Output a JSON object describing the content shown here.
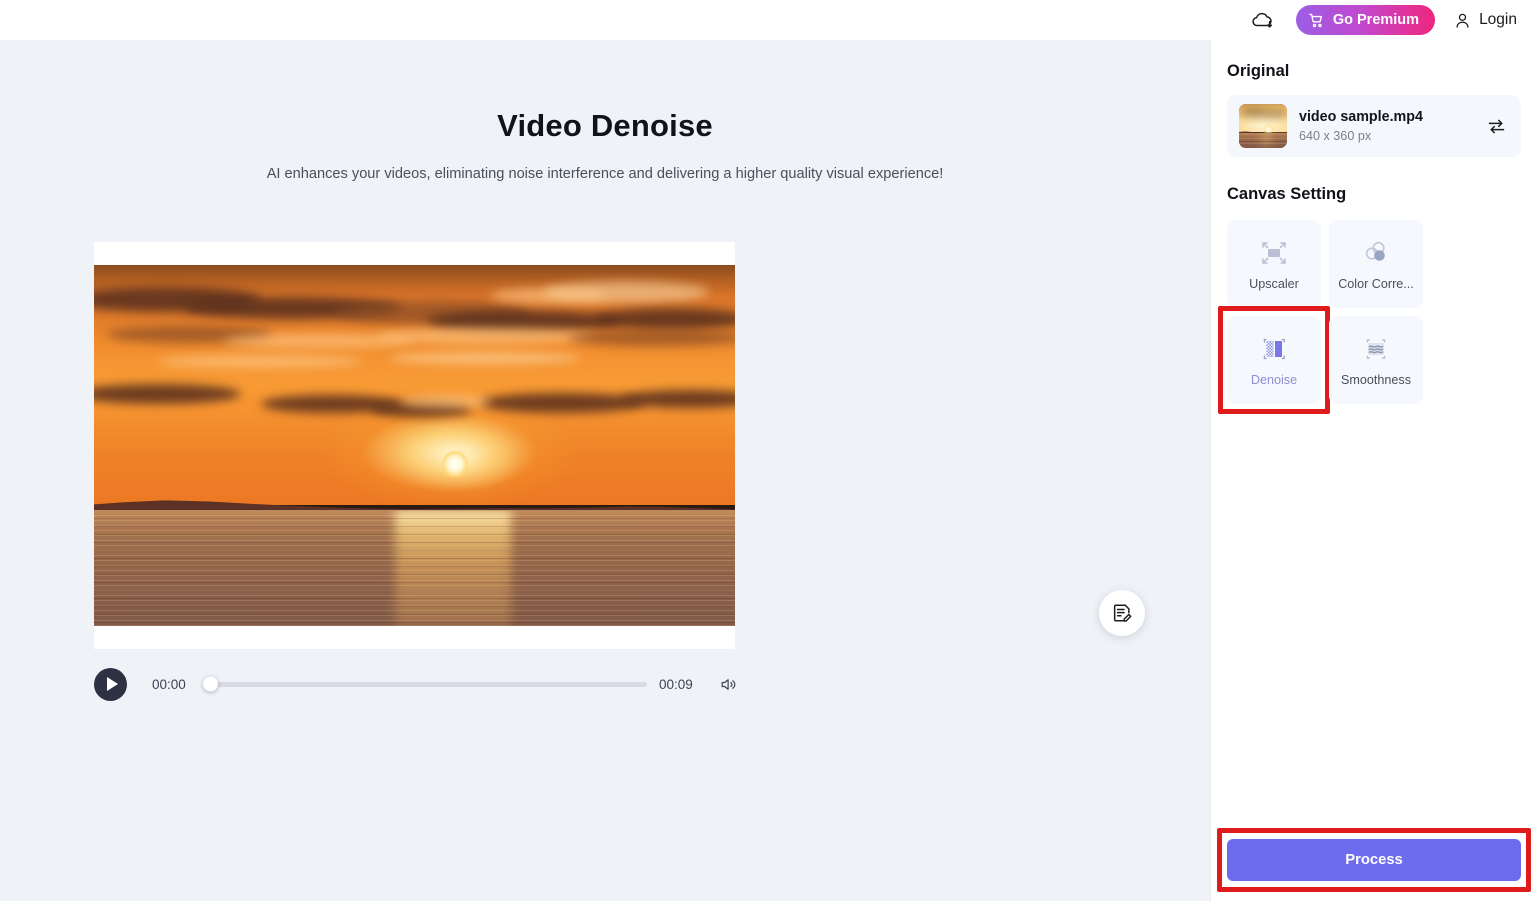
{
  "topbar": {
    "cloud_icon": "cloud-download-icon",
    "premium_label": "Go Premium",
    "cart_icon": "cart-icon",
    "login_label": "Login",
    "user_icon": "user-icon",
    "premium_gradient_from": "#9b5de5",
    "premium_gradient_to": "#f0257f"
  },
  "main": {
    "title": "Video Denoise",
    "subtitle": "AI enhances your videos, eliminating noise interference and delivering a higher quality visual experience!",
    "edit_icon": "note-edit-icon"
  },
  "player": {
    "play_icon": "play-icon",
    "current_time": "00:00",
    "total_time": "00:09",
    "volume_icon": "volume-icon",
    "progress_percent": 0,
    "track_color": "#d8dbe6",
    "play_button_color": "#2d3142"
  },
  "panel": {
    "original_title": "Original",
    "file": {
      "name": "video sample.mp4",
      "dimensions": "640 x 360 px",
      "swap_icon": "swap-icon",
      "thumbnail_icon": "video-thumbnail"
    },
    "canvas_title": "Canvas Setting",
    "tiles": [
      {
        "label": "Upscaler",
        "icon": "upscaler-icon",
        "selected": false
      },
      {
        "label": "Color Corre...",
        "icon": "color-correction-icon",
        "selected": false
      },
      {
        "label": "Denoise",
        "icon": "denoise-icon",
        "selected": true
      },
      {
        "label": "Smoothness",
        "icon": "smoothness-icon",
        "selected": false
      }
    ],
    "process_label": "Process",
    "process_color": "#6c6ced",
    "highlight_color": "#e01b1b"
  }
}
